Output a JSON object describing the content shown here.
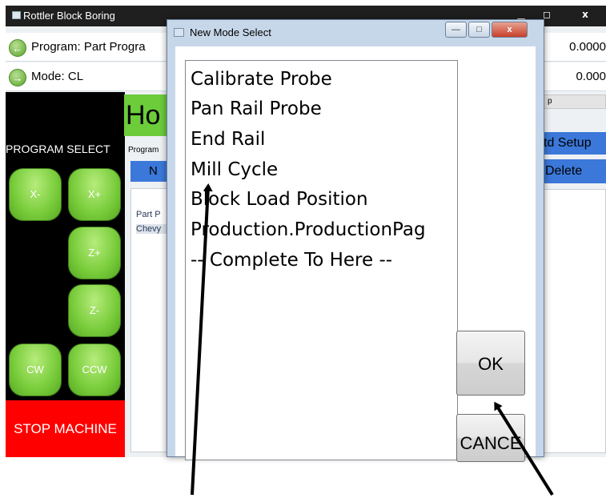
{
  "main_window": {
    "title": "Rottler Block Boring",
    "controls": {
      "minimize": "▁",
      "maximize": "◻",
      "close": "x"
    }
  },
  "header": {
    "program_label": "Program: Part Progra",
    "mode_label": "Mode: CL",
    "value_1": "0.0000",
    "value_2": "0.000"
  },
  "left_panel": {
    "program_select": "PROGRAM SELECT",
    "jog_buttons": [
      "X-",
      "X+",
      "Z+",
      "Z-",
      "CW",
      "CCW"
    ],
    "stop_machine": "STOP MACHINE"
  },
  "background": {
    "home_tab": "Ho",
    "program_caption": "Program",
    "new_button": "N",
    "list_items": [
      "Part P",
      "Chevy"
    ],
    "right_bar_text": "p",
    "std_setup": "td Setup",
    "delete": "Delete"
  },
  "dialog": {
    "title": "New Mode Select",
    "items": [
      "Calibrate Probe",
      "Pan Rail Probe",
      "End Rail",
      "Mill Cycle",
      "Block Load Position",
      "Production.ProductionPag",
      "-- Complete To Here --"
    ],
    "ok_label": "OK",
    "cancel_label": "CANCE"
  },
  "colors": {
    "accent_green": "#78cc3a",
    "stop_red": "#ff0000",
    "button_blue": "#3b78d9",
    "title_black": "#1f1f1f"
  }
}
